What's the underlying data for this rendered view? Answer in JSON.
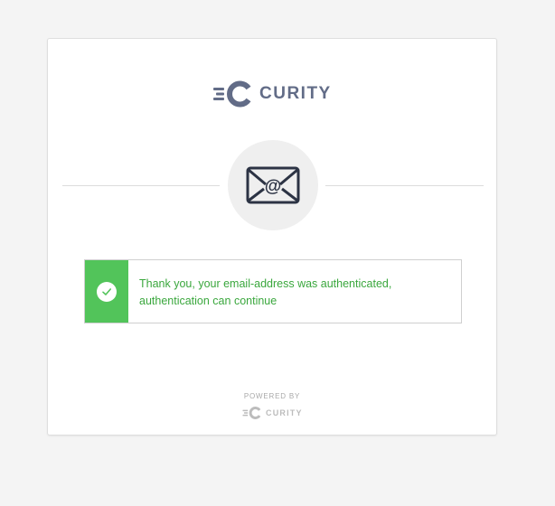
{
  "brand": {
    "name": "CURITY",
    "color": "#626c87",
    "logo_icon": "curity-logo-icon"
  },
  "header_icon": "envelope-at-icon",
  "alert": {
    "type": "success",
    "icon": "checkmark-icon",
    "accent_color": "#52c45a",
    "text_color": "#3aa73d",
    "message": "Thank you, your email-address was authenticated, authentication can continue"
  },
  "footer": {
    "powered_by": "POWERED BY",
    "brand_name": "CURITY"
  }
}
